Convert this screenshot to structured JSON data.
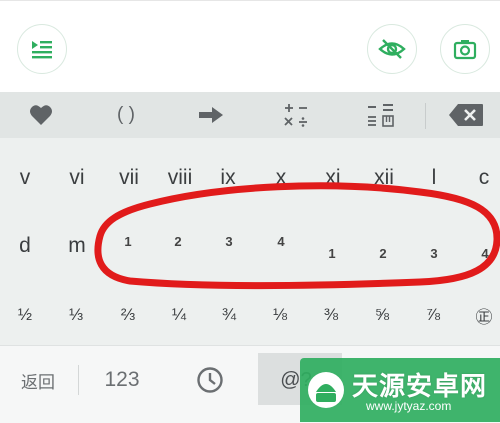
{
  "colors": {
    "accent_green": "#2fae5f",
    "highlight_red": "#e11b1b",
    "keyboard_bg": "#edf0ef"
  },
  "toolbar": {
    "left_icon": "list-play-icon",
    "right_icons": [
      "eye-off-icon",
      "camera-icon"
    ]
  },
  "function_row": {
    "items": [
      {
        "name": "favorite",
        "icon": "heart-icon"
      },
      {
        "name": "brackets",
        "label": "( )"
      },
      {
        "name": "arrow",
        "icon": "arrow-right-icon"
      },
      {
        "name": "operators",
        "icon": "plus-minus-times-divide-icon"
      },
      {
        "name": "chinese-numerals",
        "icon": "chinese-numeral-icon"
      },
      {
        "name": "backspace",
        "icon": "backspace-icon"
      }
    ]
  },
  "rows": {
    "roman": [
      "v",
      "vi",
      "vii",
      "viii",
      "ix",
      "x",
      "xi",
      "xii",
      "l",
      "c"
    ],
    "row2_letters": [
      "d",
      "m"
    ],
    "row2_numbers": [
      "1",
      "2",
      "3",
      "4",
      "1",
      "2",
      "3",
      "4"
    ],
    "fractions": [
      "½",
      "⅓",
      "⅔",
      "¼",
      "¾",
      "⅛",
      "⅜",
      "⅝",
      "⅞",
      "㊣"
    ]
  },
  "bottom_row": {
    "back": "返回",
    "num": "123",
    "clock_icon": "clock-icon",
    "symbol": "@?"
  },
  "watermark": {
    "title": "天源安卓网",
    "url": "www.jytyaz.com"
  }
}
